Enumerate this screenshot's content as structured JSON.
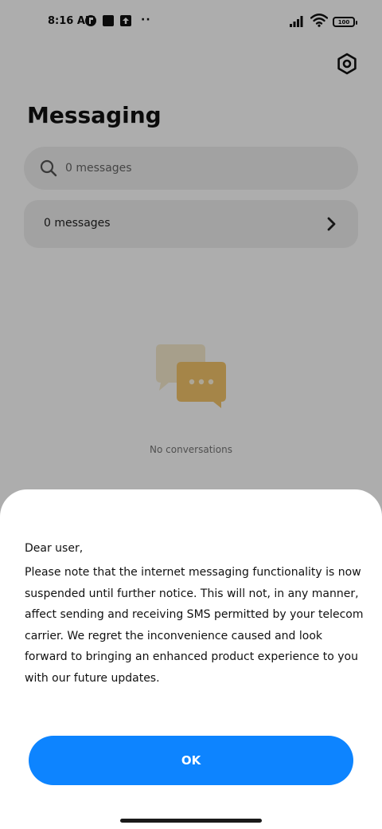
{
  "status_bar": {
    "time": "8:16 AM",
    "overflow": "··",
    "battery": "100"
  },
  "icons": {
    "notification_1": "app-notification-icon",
    "notification_2": "square-notification-icon",
    "notification_3": "upload-icon",
    "signal": "signal-icon",
    "wifi": "wifi-icon",
    "battery": "battery-icon",
    "settings": "gear-icon",
    "search": "search-icon",
    "chevron": "chevron-right-icon",
    "empty": "chat-bubbles-icon"
  },
  "header": {
    "title": "Messaging"
  },
  "search": {
    "placeholder": "0 messages"
  },
  "messages_row": {
    "label": "0 messages"
  },
  "empty_state": {
    "text": "No conversations"
  },
  "dialog": {
    "greeting": "Dear user,",
    "body": "Please note that the internet messaging functionality is now suspended until further notice. This will not, in any manner, affect sending and receiving SMS permitted by your telecom carrier. We regret the inconvenience caused and look forward to bringing an enhanced product experience to you with our future updates.",
    "ok_label": "OK"
  },
  "colors": {
    "accent": "#0d84ff",
    "scrim": "#a8a8a8",
    "sheet": "#ffffff",
    "empty_illustration": "#f3c56b"
  }
}
